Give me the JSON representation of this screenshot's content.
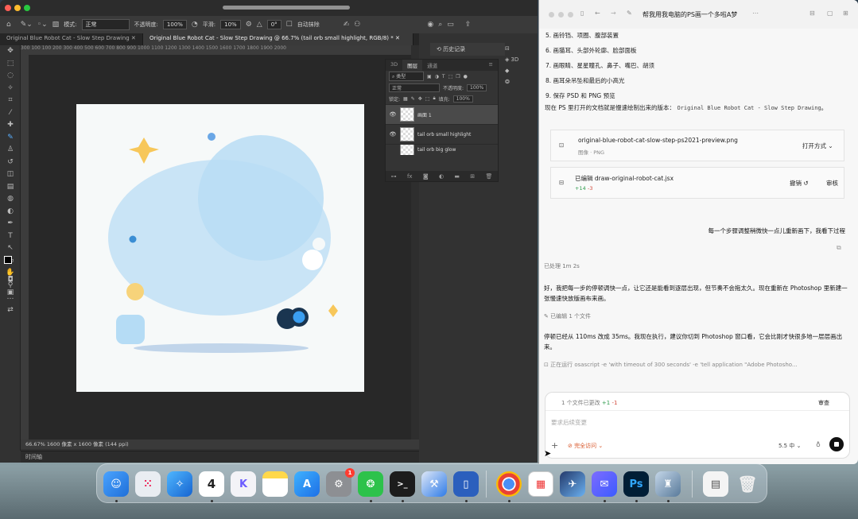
{
  "photoshop": {
    "blend_label": "模式:",
    "blend_value": "正常",
    "opacity_label": "不透明度:",
    "opacity_value": "100%",
    "smooth_label": "平滑:",
    "smooth_value": "10%",
    "angle_value": "0°",
    "auto_erase_label": "自动抹除",
    "tabs": [
      "Original Blue Robot Cat - Slow Step Drawing",
      "Original Blue Robot Cat - Slow Step Drawing @ 66.7% (tail orb small highlight, RGB/8) *"
    ],
    "ruler_ticks": "300  100  100  200  300  400  500  600  700  800  900  1000  1100  1200  1300  1400  1500  1600  1700  1800  1900  2000",
    "status_text": "66.67%    1600 像素 x 1600 像素 (144 ppi)",
    "timeline_label": "时间轴",
    "history_label": "历史记录",
    "side_3d_label": "3D",
    "layers_panel": {
      "tabs": [
        "3D",
        "图层",
        "通道"
      ],
      "kind_label": "类型",
      "blend_value": "正常",
      "opacity_label": "不透明度:",
      "opacity_value": "100%",
      "lock_label": "锁定:",
      "fill_label": "填充:",
      "fill_value": "100%",
      "layers": [
        "画面 1",
        "tail orb small highlight",
        "tail orb big glow"
      ]
    }
  },
  "chat": {
    "title": "帮我用我电脑的PS画一个多啦A梦",
    "steps": [
      "5. 画铃铛、项圈、腹部装置",
      "6. 画猫耳、头部外轮廓、脸部面板",
      "7. 画眼睛、星星瞳孔、鼻子、嘴巴、胡须",
      "8. 画耳朵吊坠和最后的小高光",
      "9. 保存 PSD 和 PNG 预览"
    ],
    "note_prefix": "现在 PS 里打开的文档就是慢速绘制出来的版本：",
    "note_doc": "Original Blue Robot Cat - Slow Step Drawing",
    "note_suffix": "。",
    "file1": {
      "name": "original-blue-robot-cat-slow-step-ps2021-preview.png",
      "type": "图像 · PNG",
      "action": "打开方式"
    },
    "file2": {
      "name": "已编辑 draw-original-robot-cat.jsx",
      "added": "+14",
      "removed": "-3",
      "undo": "撤销",
      "review": "审核"
    },
    "user_message": "每一个步骤调整稍微快一点儿重新画下，我看下过程",
    "processed": "已处理 1m 2s",
    "reply1": "好，我把每一步的停顿调快一点，让它还是能看到逐层出现，但节奏不会拖太久。现在重新在 Photoshop 里新建一张慢速快放版画布来画。",
    "edited_files": "已编辑 1 个文件",
    "reply2": "停顿已经从 110ms 改成 35ms。我现在执行，建议你切到 Photoshop 窗口看，它会比刚才快很多地一层层画出来。",
    "running": "正在运行 osascript -e 'with timeout of 300 seconds' -e 'tell application \"Adobe Photosho...",
    "changes_summary": "1 个文件已更改",
    "changes_added": "+1",
    "changes_removed": "-1",
    "review_button": "审查",
    "placeholder": "要求后续变更",
    "access_label": "完全访问",
    "model_label": "5.5 中"
  },
  "dock": {
    "apps": [
      "Finder",
      "Launchpad",
      "Safari",
      "日历",
      "Kimi",
      "备忘录",
      "App Store",
      "系统设置",
      "微信",
      "终端",
      "Xcode",
      "Simulator",
      "Chrome",
      "Calendar Grid",
      "Bird",
      "Messenger",
      "Photoshop",
      "Automator",
      "Preview",
      "废纸篓"
    ],
    "calendar_day": "4",
    "settings_badge": "1",
    "photoshop_label": "Ps"
  },
  "colors": {
    "ps_bg": "#323232",
    "canvas_bg": "#282828",
    "accent_blue": "#3b8ed4",
    "star_yellow": "#f7c75a",
    "bubble_blue": "#c4e1f5",
    "chat_bg": "#f7f7f7"
  }
}
